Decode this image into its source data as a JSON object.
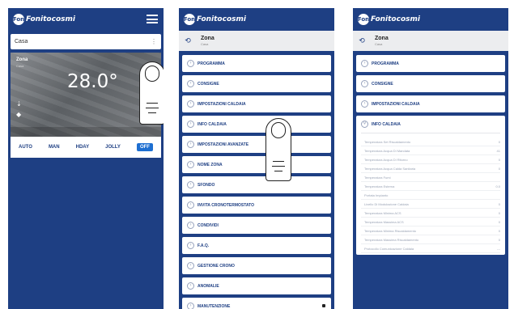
{
  "app": {
    "brand_mark": "Fon",
    "brand_name": "Fonitocosmi"
  },
  "screen1": {
    "selector_value": "Casa",
    "zone_name": "Zona",
    "zone_sub": "Casa",
    "temperature": "28.0°",
    "modes": [
      "AUTO",
      "MAN",
      "HDAY",
      "JOLLY",
      "OFF"
    ],
    "active_mode": "OFF"
  },
  "screen2": {
    "zone_title": "Zona",
    "zone_subtitle": "Casa",
    "menu": [
      "PROGRAMMA",
      "CONSIGNE",
      "IMPOSTAZIONI CALDAIA",
      "INFO CALDAIA",
      "IMPOSTAZIONI AVANZATE",
      "NOME ZONA",
      "SFONDO",
      "INVITA CRONOTERMOSTATO",
      "CONDIVIDI",
      "F.A.Q.",
      "GESTIONE CRONO",
      "ANOMALIE",
      "MANUTENZIONE"
    ]
  },
  "screen3": {
    "zone_title": "Zona",
    "zone_subtitle": "Casa",
    "menu": [
      "PROGRAMMA",
      "CONSIGNE",
      "IMPOSTAZIONI CALDAIA"
    ],
    "info_title": "INFO CALDAIA",
    "info_rows": [
      {
        "label": "Temperatura Set Riscaldamento",
        "value": "0"
      },
      {
        "label": "Temperatura Acqua Di Mandata",
        "value": "41"
      },
      {
        "label": "Temperatura Acqua Di Ritorno",
        "value": "0"
      },
      {
        "label": "Temperatura Acqua Calda Sanitaria",
        "value": "0"
      },
      {
        "label": "Temperatura Fumi",
        "value": ""
      },
      {
        "label": "Temperatura Esterna",
        "value": "0.0"
      },
      {
        "label": "Portata Impianto",
        "value": ""
      },
      {
        "label": "Livello Di Modulazione Caldaia",
        "value": "0"
      },
      {
        "label": "Temperatura Minima ACS",
        "value": "0"
      },
      {
        "label": "Temperatura Massima ACS",
        "value": "0"
      },
      {
        "label": "Temperatura Minima Riscaldamento",
        "value": "0"
      },
      {
        "label": "Temperatura Massima Riscaldamento",
        "value": "0"
      },
      {
        "label": "Protocollo Comunicazione Caldaia",
        "value": "---"
      }
    ]
  }
}
